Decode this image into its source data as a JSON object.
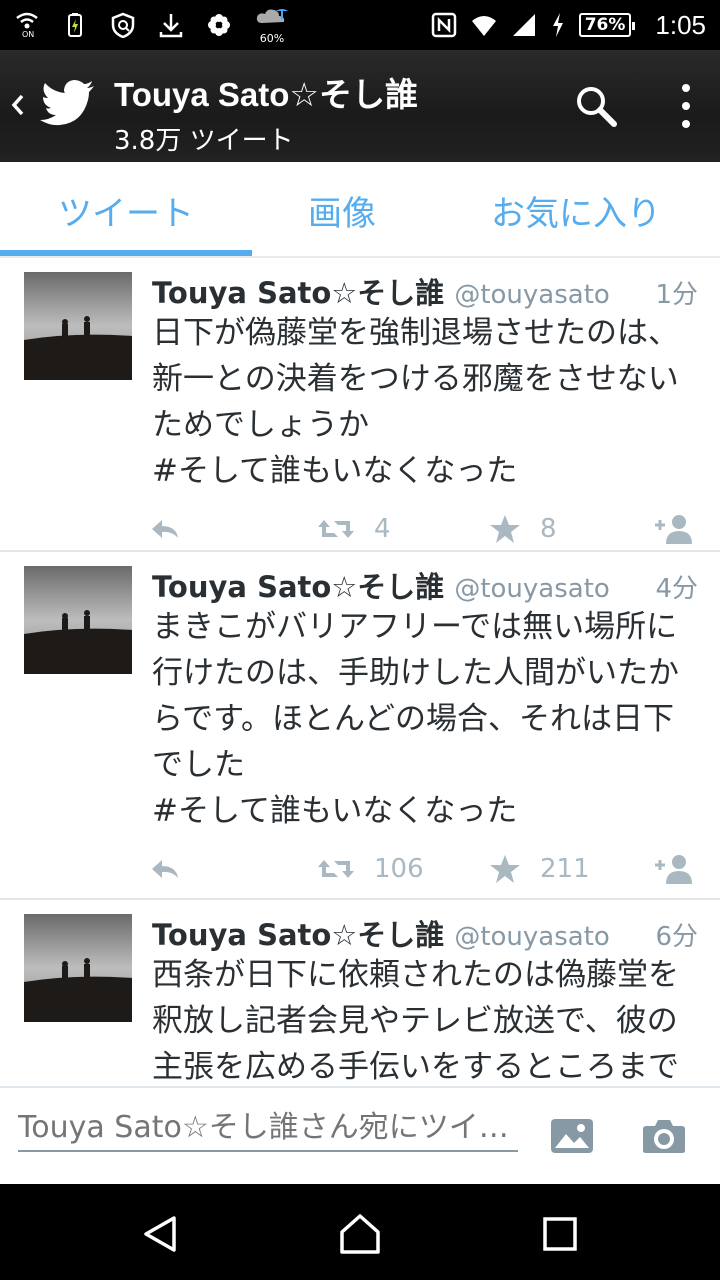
{
  "status_bar": {
    "weather_pct": "60%",
    "battery": "76%",
    "time": "1:05",
    "icons": [
      "nfc-on-icon",
      "battery-saver-icon",
      "shield-icon",
      "download-icon",
      "flower-icon",
      "weather-icon",
      "nfc-icon",
      "wifi-icon",
      "signal-icon",
      "charging-icon"
    ]
  },
  "header": {
    "title": "Touya Sato☆そし誰",
    "subtitle": "3.8万 ツイート"
  },
  "tabs": [
    {
      "label": "ツイート",
      "active": true
    },
    {
      "label": "画像",
      "active": false
    },
    {
      "label": "お気に入り",
      "active": false
    }
  ],
  "tweets": [
    {
      "name": "Touya Sato☆そし誰",
      "handle": "@touyasato",
      "time": "1分",
      "text": "日下が偽藤堂を強制退場させたのは、\n新一との決着をつける邪魔をさせない\nためでしょうか\n#そして誰もいなくなった",
      "retweets": "4",
      "favorites": "8"
    },
    {
      "name": "Touya Sato☆そし誰",
      "handle": "@touyasato",
      "time": "4分",
      "text": "まきこがバリアフリーでは無い場所に\n行けたのは、手助けした人間がいたか\nらです。ほとんどの場合、それは日下\nでした\n#そして誰もいなくなった",
      "retweets": "106",
      "favorites": "211"
    },
    {
      "name": "Touya Sato☆そし誰",
      "handle": "@touyasato",
      "time": "6分",
      "text": "西条が日下に依頼されたのは偽藤堂を\n釈放し記者会見やテレビ放送で、彼の\n主張を広める手伝いをするところまで",
      "retweets": "",
      "favorites": ""
    }
  ],
  "compose": {
    "placeholder": "Touya Sato☆そし誰さん宛にツイ…"
  },
  "colors": {
    "accent": "#55acee",
    "muted": "#aab8c2",
    "text": "#292f33"
  }
}
